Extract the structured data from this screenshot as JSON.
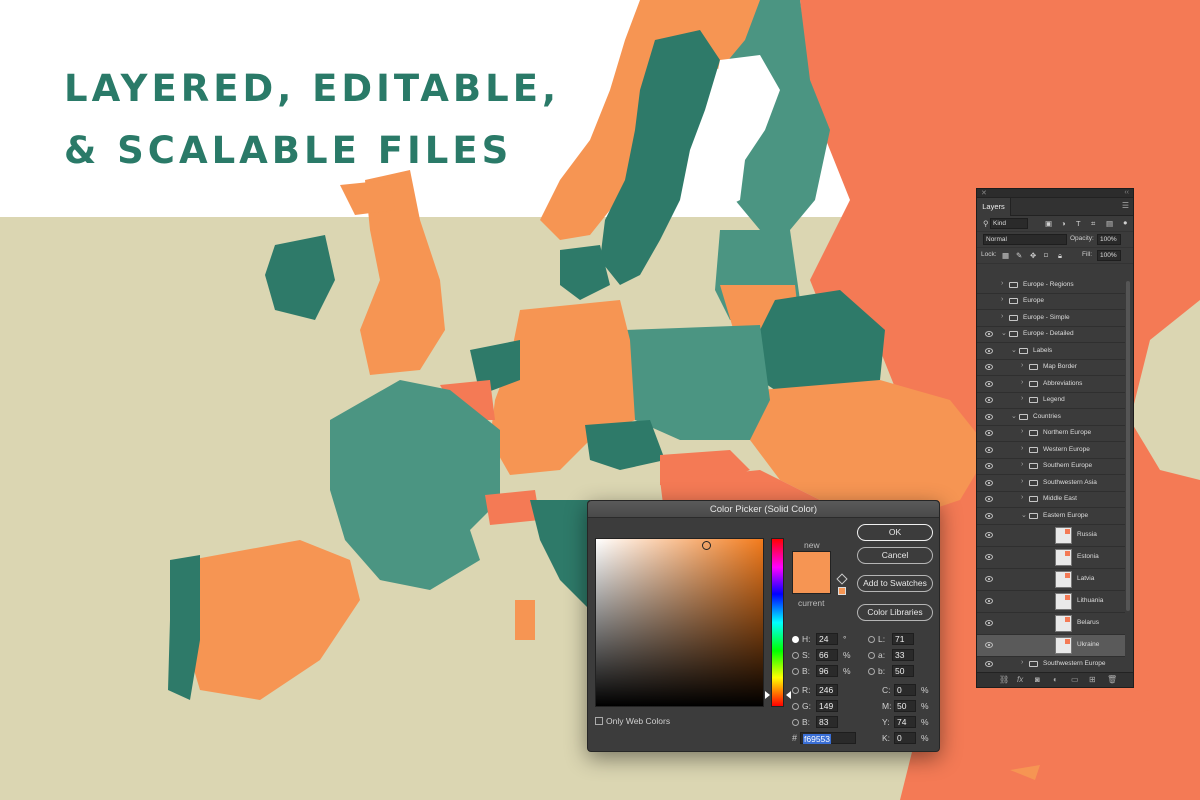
{
  "headline": {
    "line1": "LAYERED, EDITABLE,",
    "line2": "& SCALABLE FILES"
  },
  "colors": {
    "teal_dark": "#2e7a69",
    "teal_light": "#4b9582",
    "orange": "#f69553",
    "coral": "#f47a55",
    "background": "#dbd6b2",
    "headline": "#2a7a68"
  },
  "color_picker": {
    "title": "Color Picker (Solid Color)",
    "label_new": "new",
    "label_current": "current",
    "buttons": {
      "ok": "OK",
      "cancel": "Cancel",
      "add_to_swatches": "Add to Swatches",
      "color_libraries": "Color Libraries"
    },
    "hsb": [
      {
        "label": "H:",
        "value": "24",
        "unit": "°",
        "selected": true
      },
      {
        "label": "S:",
        "value": "66",
        "unit": "%",
        "selected": false
      },
      {
        "label": "B:",
        "value": "96",
        "unit": "%",
        "selected": false
      }
    ],
    "rgb": [
      {
        "label": "R:",
        "value": "246"
      },
      {
        "label": "G:",
        "value": "149"
      },
      {
        "label": "B:",
        "value": "83"
      }
    ],
    "lab": [
      {
        "label": "L:",
        "value": "71"
      },
      {
        "label": "a:",
        "value": "33"
      },
      {
        "label": "b:",
        "value": "50"
      }
    ],
    "cmyk": [
      {
        "label": "C:",
        "value": "0",
        "unit": "%"
      },
      {
        "label": "M:",
        "value": "50",
        "unit": "%"
      },
      {
        "label": "Y:",
        "value": "74",
        "unit": "%"
      },
      {
        "label": "K:",
        "value": "0",
        "unit": "%"
      }
    ],
    "hex_label": "#",
    "hex": "f69553",
    "only_web_colors": "Only Web Colors"
  },
  "layers_panel": {
    "tab": "Layers",
    "filter_kind": "Kind",
    "blend_mode": "Normal",
    "opacity_label": "Opacity:",
    "opacity": "100%",
    "lock_label": "Lock:",
    "fill_label": "Fill:",
    "fill": "100%",
    "layers": [
      {
        "name": "Europe - Regions",
        "visible": false,
        "indent": 0,
        "type": "group",
        "open": false
      },
      {
        "name": "Europe",
        "visible": false,
        "indent": 0,
        "type": "group",
        "open": false
      },
      {
        "name": "Europe - Simple",
        "visible": false,
        "indent": 0,
        "type": "group",
        "open": false
      },
      {
        "name": "Europe - Detailed",
        "visible": true,
        "indent": 0,
        "type": "group",
        "open": true
      },
      {
        "name": "Labels",
        "visible": true,
        "indent": 1,
        "type": "group",
        "open": true
      },
      {
        "name": "Map Border",
        "visible": true,
        "indent": 2,
        "type": "group",
        "open": false
      },
      {
        "name": "Abbreviations",
        "visible": true,
        "indent": 2,
        "type": "group",
        "open": false
      },
      {
        "name": "Legend",
        "visible": true,
        "indent": 2,
        "type": "group",
        "open": false
      },
      {
        "name": "Countries",
        "visible": true,
        "indent": 1,
        "type": "group",
        "open": true
      },
      {
        "name": "Northern Europe",
        "visible": true,
        "indent": 2,
        "type": "group",
        "open": false
      },
      {
        "name": "Western Europe",
        "visible": true,
        "indent": 2,
        "type": "group",
        "open": false
      },
      {
        "name": "Southern Europe",
        "visible": true,
        "indent": 2,
        "type": "group",
        "open": false
      },
      {
        "name": "Southwestern Asia",
        "visible": true,
        "indent": 2,
        "type": "group",
        "open": false
      },
      {
        "name": "Middle East",
        "visible": true,
        "indent": 2,
        "type": "group",
        "open": false
      },
      {
        "name": "Eastern Europe",
        "visible": true,
        "indent": 2,
        "type": "group",
        "open": true
      },
      {
        "name": "Russia",
        "visible": true,
        "indent": 3,
        "type": "layer"
      },
      {
        "name": "Estonia",
        "visible": true,
        "indent": 3,
        "type": "layer"
      },
      {
        "name": "Latvia",
        "visible": true,
        "indent": 3,
        "type": "layer"
      },
      {
        "name": "Lithuania",
        "visible": true,
        "indent": 3,
        "type": "layer"
      },
      {
        "name": "Belarus",
        "visible": true,
        "indent": 3,
        "type": "layer"
      },
      {
        "name": "Ukraine",
        "visible": true,
        "indent": 3,
        "type": "layer",
        "selected": true
      },
      {
        "name": "Southwestern Europe",
        "visible": true,
        "indent": 2,
        "type": "group",
        "open": false
      }
    ]
  }
}
